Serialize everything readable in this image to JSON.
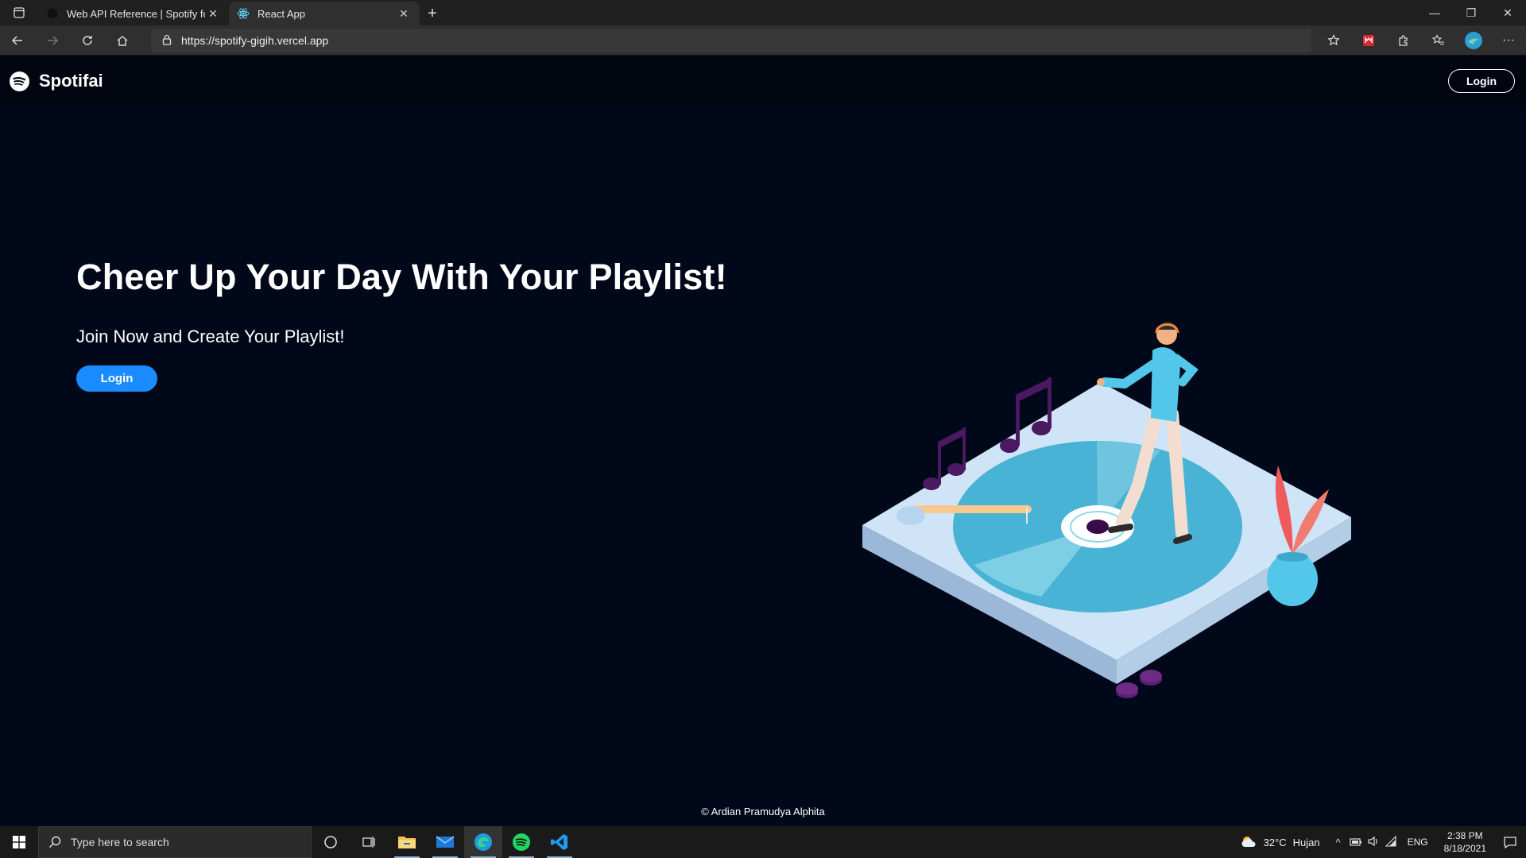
{
  "browser": {
    "tabs": [
      {
        "title": "Web API Reference | Spotify for Developers",
        "icon": "spotify-dev-icon",
        "active": false
      },
      {
        "title": "React App",
        "icon": "react-icon",
        "active": true
      }
    ],
    "address": "https://spotify-gigih.vercel.app"
  },
  "header": {
    "brand": "Spotifai",
    "login_label": "Login"
  },
  "hero": {
    "title": "Cheer Up Your Day With Your Playlist!",
    "subtitle": "Join Now and Create Your Playlist!",
    "login_label": "Login"
  },
  "footer": {
    "text": "© Ardian Pramudya Alphita"
  },
  "taskbar": {
    "search_placeholder": "Type here to search",
    "weather_temp": "32°C",
    "weather_text": "Hujan",
    "lang": "ENG",
    "time": "2:38 PM",
    "date": "8/18/2021"
  },
  "colors": {
    "page_bg": "#010819",
    "header_bg": "#000510",
    "accent": "#1a8cff"
  }
}
